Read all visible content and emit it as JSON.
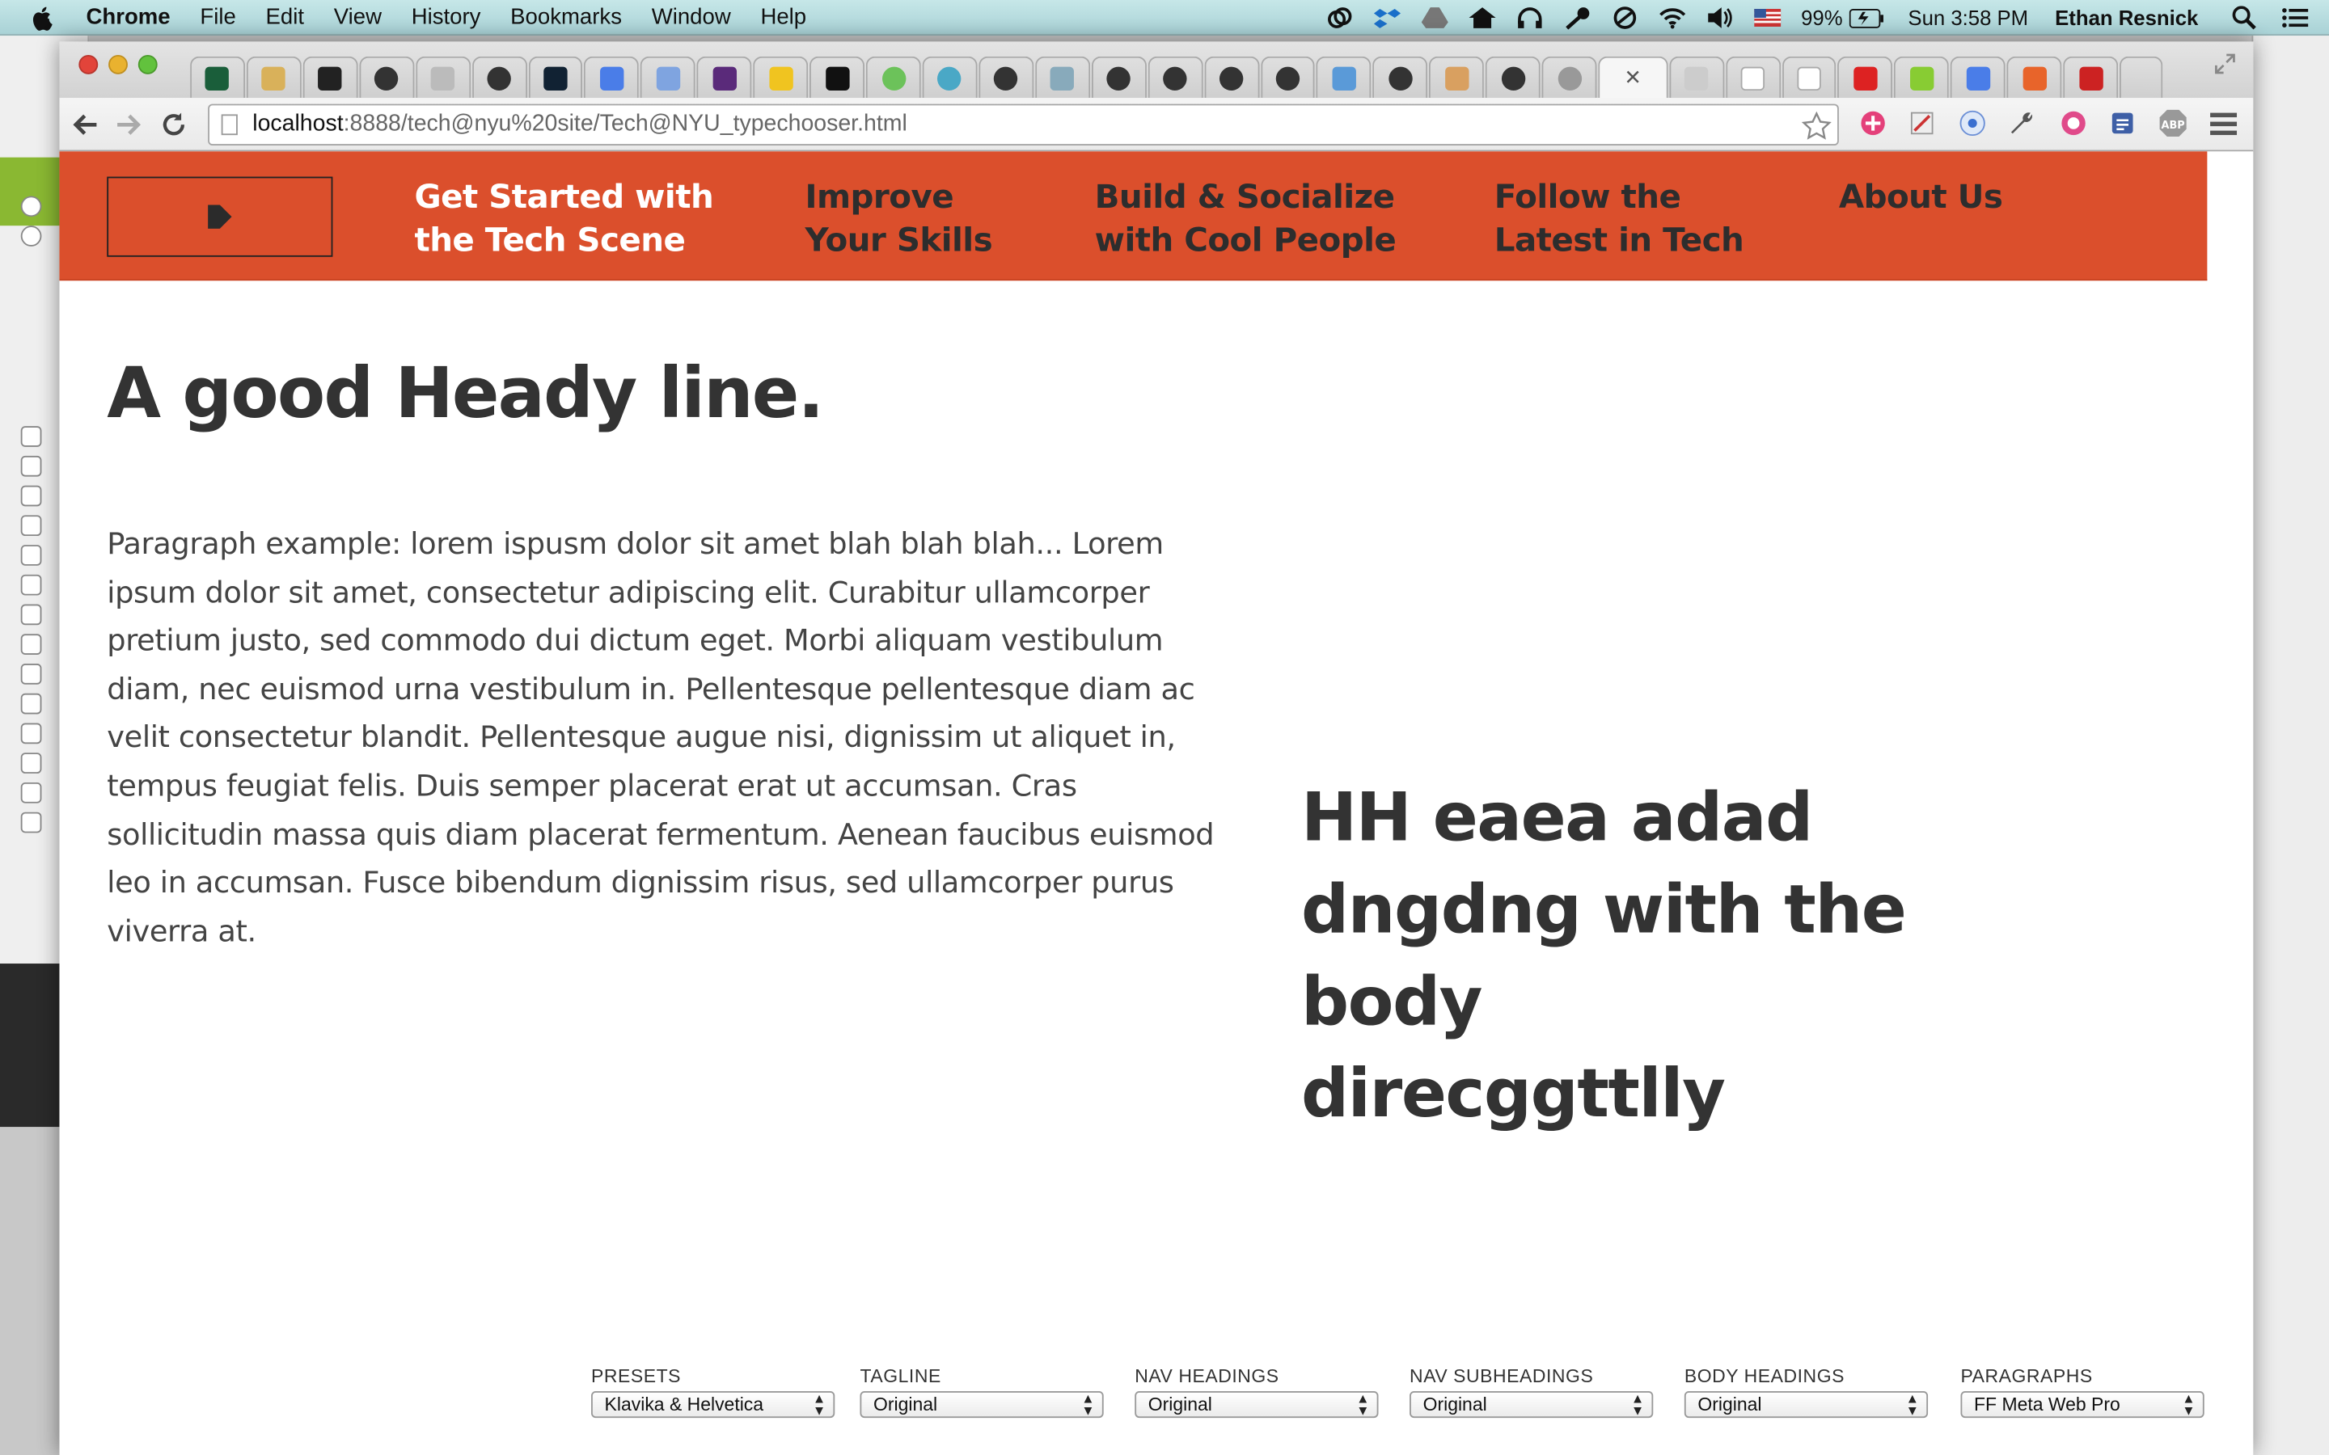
{
  "menubar": {
    "app_name": "Chrome",
    "items": [
      "File",
      "Edit",
      "View",
      "History",
      "Bookmarks",
      "Window",
      "Help"
    ],
    "battery": "99%",
    "clock": "Sun 3:58 PM",
    "user": "Ethan Resnick"
  },
  "browser": {
    "url_host": "localhost",
    "url_path": ":8888/tech@nyu%20site/Tech@NYU_typechooser.html"
  },
  "page": {
    "nav": {
      "items": [
        {
          "line1": "Get Started with",
          "line2": "the Tech Scene"
        },
        {
          "line1": "Improve",
          "line2": "Your Skills"
        },
        {
          "line1": "Build & Socialize",
          "line2": "with Cool People"
        },
        {
          "line1": "Follow the",
          "line2": "Latest in Tech"
        },
        {
          "line1": "About Us",
          "line2": ""
        }
      ]
    },
    "headline": "A good Heady line.",
    "paragraph": "Paragraph example: lorem ispusm dolor sit amet blah blah blah... Lorem ipsum dolor sit amet, consectetur adipiscing elit. Curabitur ullamcorper pretium justo, sed commodo dui dictum eget. Morbi aliquam vestibulum diam, nec euismod urna vestibulum in. Pellentesque pellentesque diam ac velit consectetur blandit. Pellentesque augue nisi, dignissim ut aliquet in, tempus feugiat felis. Duis semper placerat erat ut accumsan. Cras sollicitudin massa quis diam placerat fermentum. Aenean faucibus euismod leo in accumsan. Fusce bibendum dignissim risus, sed ullamcorper purus viverra at.",
    "sample_heading": "HH eaea adad dngdng with the body direcggttlly"
  },
  "controls": [
    {
      "label": "PRESETS",
      "value": "Klavika & Helvetica"
    },
    {
      "label": "TAGLINE",
      "value": "Original"
    },
    {
      "label": "NAV HEADINGS",
      "value": "Original"
    },
    {
      "label": "NAV SUBHEADINGS",
      "value": "Original"
    },
    {
      "label": "BODY HEADINGS",
      "value": "Original"
    },
    {
      "label": "PARAGRAPHS",
      "value": "FF Meta Web Pro"
    }
  ],
  "colors": {
    "nav_bg": "#db4f2c",
    "nav_text": "#2d2d2d",
    "nav_active_text": "#ffffff",
    "body_text": "#444444"
  }
}
